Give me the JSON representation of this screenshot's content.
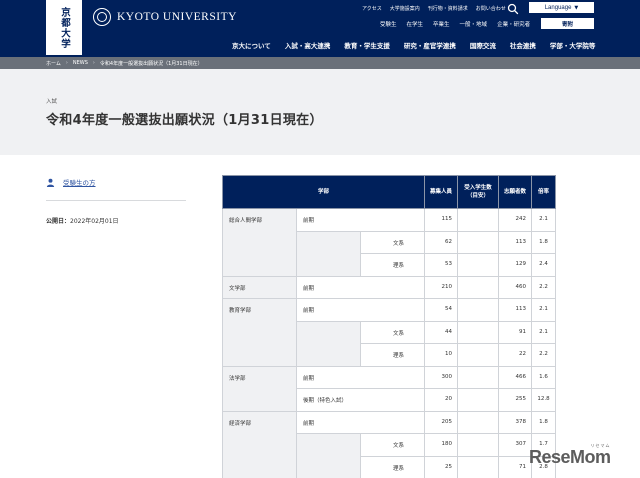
{
  "header": {
    "logo_vertical": "京都大学",
    "university_name": "KYOTO UNIVERSITY",
    "utility_links": [
      "アクセス",
      "大学施設案内",
      "刊行物・資料請求",
      "お問い合わせ"
    ],
    "language_label": "Language",
    "audience_links": [
      "受験生",
      "在学生",
      "卒業生",
      "一般・地域",
      "企業・研究者"
    ],
    "donate_label": "寄附",
    "main_nav": [
      "京大について",
      "入試・高大連携",
      "教育・学生支援",
      "研究・産官学連携",
      "国際交流",
      "社会連携",
      "学部・大学院等"
    ]
  },
  "breadcrumb": [
    "ホーム",
    "NEWS",
    "令和4年度一般選抜出願状況（1月31日現在）"
  ],
  "page": {
    "category": "入試",
    "title": "令和4年度一般選抜出願状況（1月31日現在）",
    "audience_label": "受験生の方",
    "published_label": "公開日：",
    "published_date": "2022年02月01日"
  },
  "table": {
    "headers": {
      "faculty": "学部",
      "capacity": "募集人員",
      "intl": "受入学生数\n（目安）",
      "applicants": "志願者数",
      "ratio": "倍率"
    },
    "rows": [
      {
        "faculty": "総合人間学部",
        "session": "前期",
        "track": "",
        "capacity": "115",
        "intl": "",
        "applicants": "242",
        "ratio": "2.1"
      },
      {
        "faculty": "",
        "session": "",
        "track": "文系",
        "capacity": "62",
        "intl": "",
        "applicants": "113",
        "ratio": "1.8"
      },
      {
        "faculty": "",
        "session": "",
        "track": "理系",
        "capacity": "53",
        "intl": "",
        "applicants": "129",
        "ratio": "2.4"
      },
      {
        "faculty": "文学部",
        "session": "前期",
        "track": "",
        "capacity": "210",
        "intl": "",
        "applicants": "460",
        "ratio": "2.2"
      },
      {
        "faculty": "教育学部",
        "session": "前期",
        "track": "",
        "capacity": "54",
        "intl": "",
        "applicants": "113",
        "ratio": "2.1"
      },
      {
        "faculty": "",
        "session": "",
        "track": "文系",
        "capacity": "44",
        "intl": "",
        "applicants": "91",
        "ratio": "2.1"
      },
      {
        "faculty": "",
        "session": "",
        "track": "理系",
        "capacity": "10",
        "intl": "",
        "applicants": "22",
        "ratio": "2.2"
      },
      {
        "faculty": "法学部",
        "session": "前期",
        "track": "",
        "capacity": "300",
        "intl": "",
        "applicants": "466",
        "ratio": "1.6"
      },
      {
        "faculty": "",
        "session": "後期（特色入試）",
        "track": "",
        "capacity": "20",
        "intl": "",
        "applicants": "255",
        "ratio": "12.8"
      },
      {
        "faculty": "経済学部",
        "session": "前期",
        "track": "",
        "capacity": "205",
        "intl": "",
        "applicants": "378",
        "ratio": "1.8"
      },
      {
        "faculty": "",
        "session": "",
        "track": "文系",
        "capacity": "180",
        "intl": "",
        "applicants": "307",
        "ratio": "1.7"
      },
      {
        "faculty": "",
        "session": "",
        "track": "理系",
        "capacity": "25",
        "intl": "",
        "applicants": "71",
        "ratio": "2.8"
      }
    ]
  },
  "watermark": {
    "kana": "リセマム",
    "brand": "ReseMom"
  },
  "colors": {
    "navy": "#00205b",
    "breadcrumb_bg": "#6a7079",
    "band_bg": "#f0f1f3",
    "link": "#2f54a1"
  }
}
